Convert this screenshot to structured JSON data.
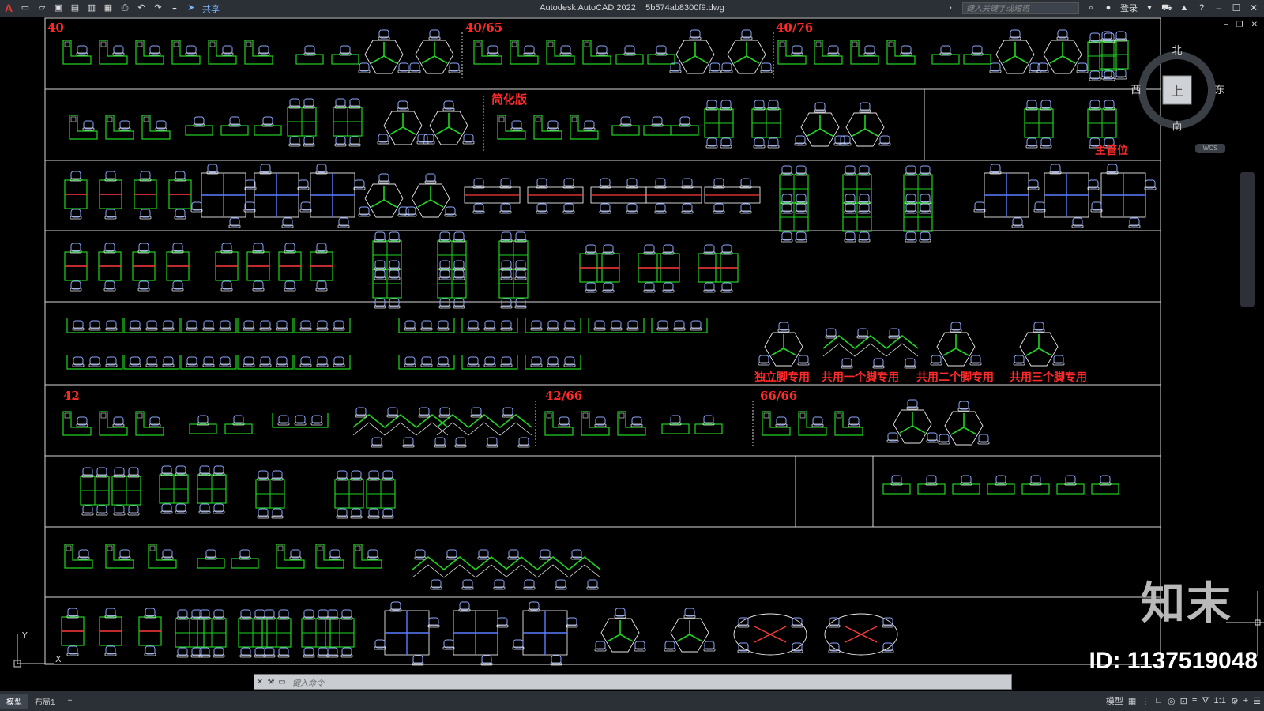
{
  "titlebar": {
    "app": "Autodesk AutoCAD 2022",
    "file": "5b574ab8300f9.dwg",
    "share_label": "共享",
    "search_placeholder": "键入关键字或短语",
    "login_label": "登录"
  },
  "sections": {
    "row1": {
      "a": "40",
      "b": "40/65",
      "c": "40/76"
    },
    "row2": {
      "simplified": "简化版",
      "manager": "主管位"
    },
    "row6": {
      "a": "42",
      "b": "42/66",
      "c": "66/66"
    },
    "legs": [
      "独立脚专用",
      "共用一个脚专用",
      "共用二个脚专用",
      "共用三个脚专用"
    ]
  },
  "viewcube": {
    "north": "北",
    "south": "南",
    "east": "东",
    "west": "西",
    "face": "上",
    "wcs": "WCS"
  },
  "ucs": {
    "y": "Y",
    "x": "X"
  },
  "tabs": {
    "model": "模型",
    "layout1": "布局1",
    "add": "+"
  },
  "command": {
    "placeholder": "键入命令"
  },
  "status": {
    "model": "模型",
    "scale": "1:1"
  },
  "watermark": {
    "brand": "知末",
    "id": "ID: 1137519048"
  },
  "colors": {
    "green": "#21d321",
    "white": "#e8e8e8",
    "blue": "#5a7dff",
    "red": "#ff2a2a",
    "frame": "#d6d6d6"
  }
}
